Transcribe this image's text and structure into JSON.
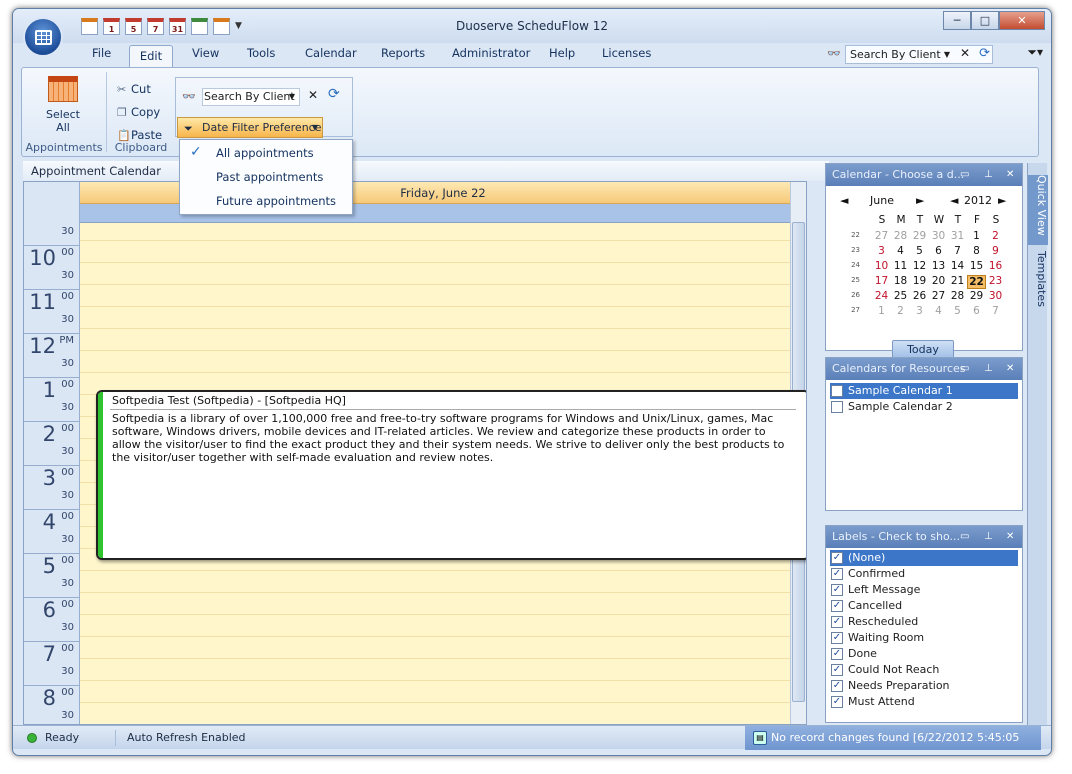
{
  "window": {
    "title": "Duoserve ScheduFlow 12",
    "minimize": "─",
    "maximize": "□",
    "close": "✕"
  },
  "qat": {
    "items": [
      "",
      "1",
      "5",
      "7",
      "31",
      "",
      ""
    ],
    "arrow": "▼"
  },
  "menu": {
    "items": [
      "File",
      "Edit",
      "View",
      "Tools",
      "Calendar",
      "Reports",
      "Administrator",
      "Help",
      "Licenses"
    ]
  },
  "top_search": {
    "value": "Search By Client",
    "arrow": "▼",
    "clear": "✕"
  },
  "ribbon": {
    "select_all": {
      "line1": "Select",
      "line2": "All"
    },
    "appointments_group": "Appointments",
    "clipboard": {
      "cut": "Cut",
      "copy": "Copy",
      "paste": "Paste",
      "group": "Clipboard"
    },
    "search": {
      "value": "Search By Client",
      "arrow": "▼",
      "clear": "✕"
    },
    "date_filter_button": "Date Filter Preference",
    "dropdown_arrow": "▼"
  },
  "date_filter_menu": {
    "check": "✓",
    "options": [
      "All appointments",
      "Past appointments",
      "Future appointments"
    ]
  },
  "calendar": {
    "section_label": "Appointment Calendar",
    "day_header": "Friday, June 22",
    "hours": [
      {
        "h": "",
        "m": ""
      },
      {
        "h": "10",
        "m": "00"
      },
      {
        "h": "11",
        "m": "00"
      },
      {
        "h": "12",
        "m": "PM"
      },
      {
        "h": "1",
        "m": "00"
      },
      {
        "h": "2",
        "m": "00"
      },
      {
        "h": "3",
        "m": "00"
      },
      {
        "h": "4",
        "m": "00"
      },
      {
        "h": "5",
        "m": "00"
      },
      {
        "h": "6",
        "m": "00"
      },
      {
        "h": "7",
        "m": "00"
      },
      {
        "h": "8",
        "m": "00"
      }
    ],
    "half_label": "30",
    "appointment": {
      "subject": "Softpedia Test (Softpedia) - [Softpedia HQ]",
      "body": "Softpedia is a library of over 1,100,000 free and free-to-try software programs for Windows and Unix/Linux, games, Mac software, Windows drivers, mobile devices and IT-related articles. We review and categorize these products in order to allow the visitor/user to find the exact product they and their system needs. We strive to deliver only the best products to the visitor/user together with self-made evaluation and review notes."
    }
  },
  "mini_calendar": {
    "panel_title": "Calendar - Choose a d...",
    "month": "June",
    "year": "2012",
    "prev": "◄",
    "next": "►",
    "day_names": [
      "S",
      "M",
      "T",
      "W",
      "T",
      "F",
      "S"
    ],
    "weeks": [
      {
        "wk": "22",
        "days": [
          "27",
          "28",
          "29",
          "30",
          "31",
          "1",
          "2"
        ]
      },
      {
        "wk": "23",
        "days": [
          "3",
          "4",
          "5",
          "6",
          "7",
          "8",
          "9"
        ]
      },
      {
        "wk": "24",
        "days": [
          "10",
          "11",
          "12",
          "13",
          "14",
          "15",
          "16"
        ]
      },
      {
        "wk": "25",
        "days": [
          "17",
          "18",
          "19",
          "20",
          "21",
          "22",
          "23"
        ]
      },
      {
        "wk": "26",
        "days": [
          "24",
          "25",
          "26",
          "27",
          "28",
          "29",
          "30"
        ]
      },
      {
        "wk": "27",
        "days": [
          "1",
          "2",
          "3",
          "4",
          "5",
          "6",
          "7"
        ]
      }
    ],
    "selected_day": "22",
    "today_button": "Today"
  },
  "resources_panel": {
    "title": "Calendars for Resources",
    "items": [
      {
        "label": "Sample Calendar 1",
        "checked": false,
        "selected": true
      },
      {
        "label": "Sample Calendar 2",
        "checked": false,
        "selected": false
      }
    ]
  },
  "labels_panel": {
    "title": "Labels - Check to sho...",
    "check": "✓",
    "items": [
      "(None)",
      "Confirmed",
      "Left Message",
      "Cancelled",
      "Rescheduled",
      "Waiting Room",
      "Done",
      "Could Not Reach",
      "Needs Preparation",
      "Must Attend"
    ]
  },
  "panel_controls": {
    "menu": "▭",
    "pin": "⊥",
    "close": "✕"
  },
  "side_tabs": [
    "Quick View",
    "Templates"
  ],
  "status": {
    "ready": "Ready",
    "auto_refresh": "Auto Refresh Enabled",
    "changes": "No record changes found [6/22/2012 5:45:05 PM]"
  },
  "colors": {
    "accent": "#3b76c9",
    "appointment_bar": "#2fc42f",
    "today": "#f4bd66",
    "red_day": "#c0102a"
  }
}
